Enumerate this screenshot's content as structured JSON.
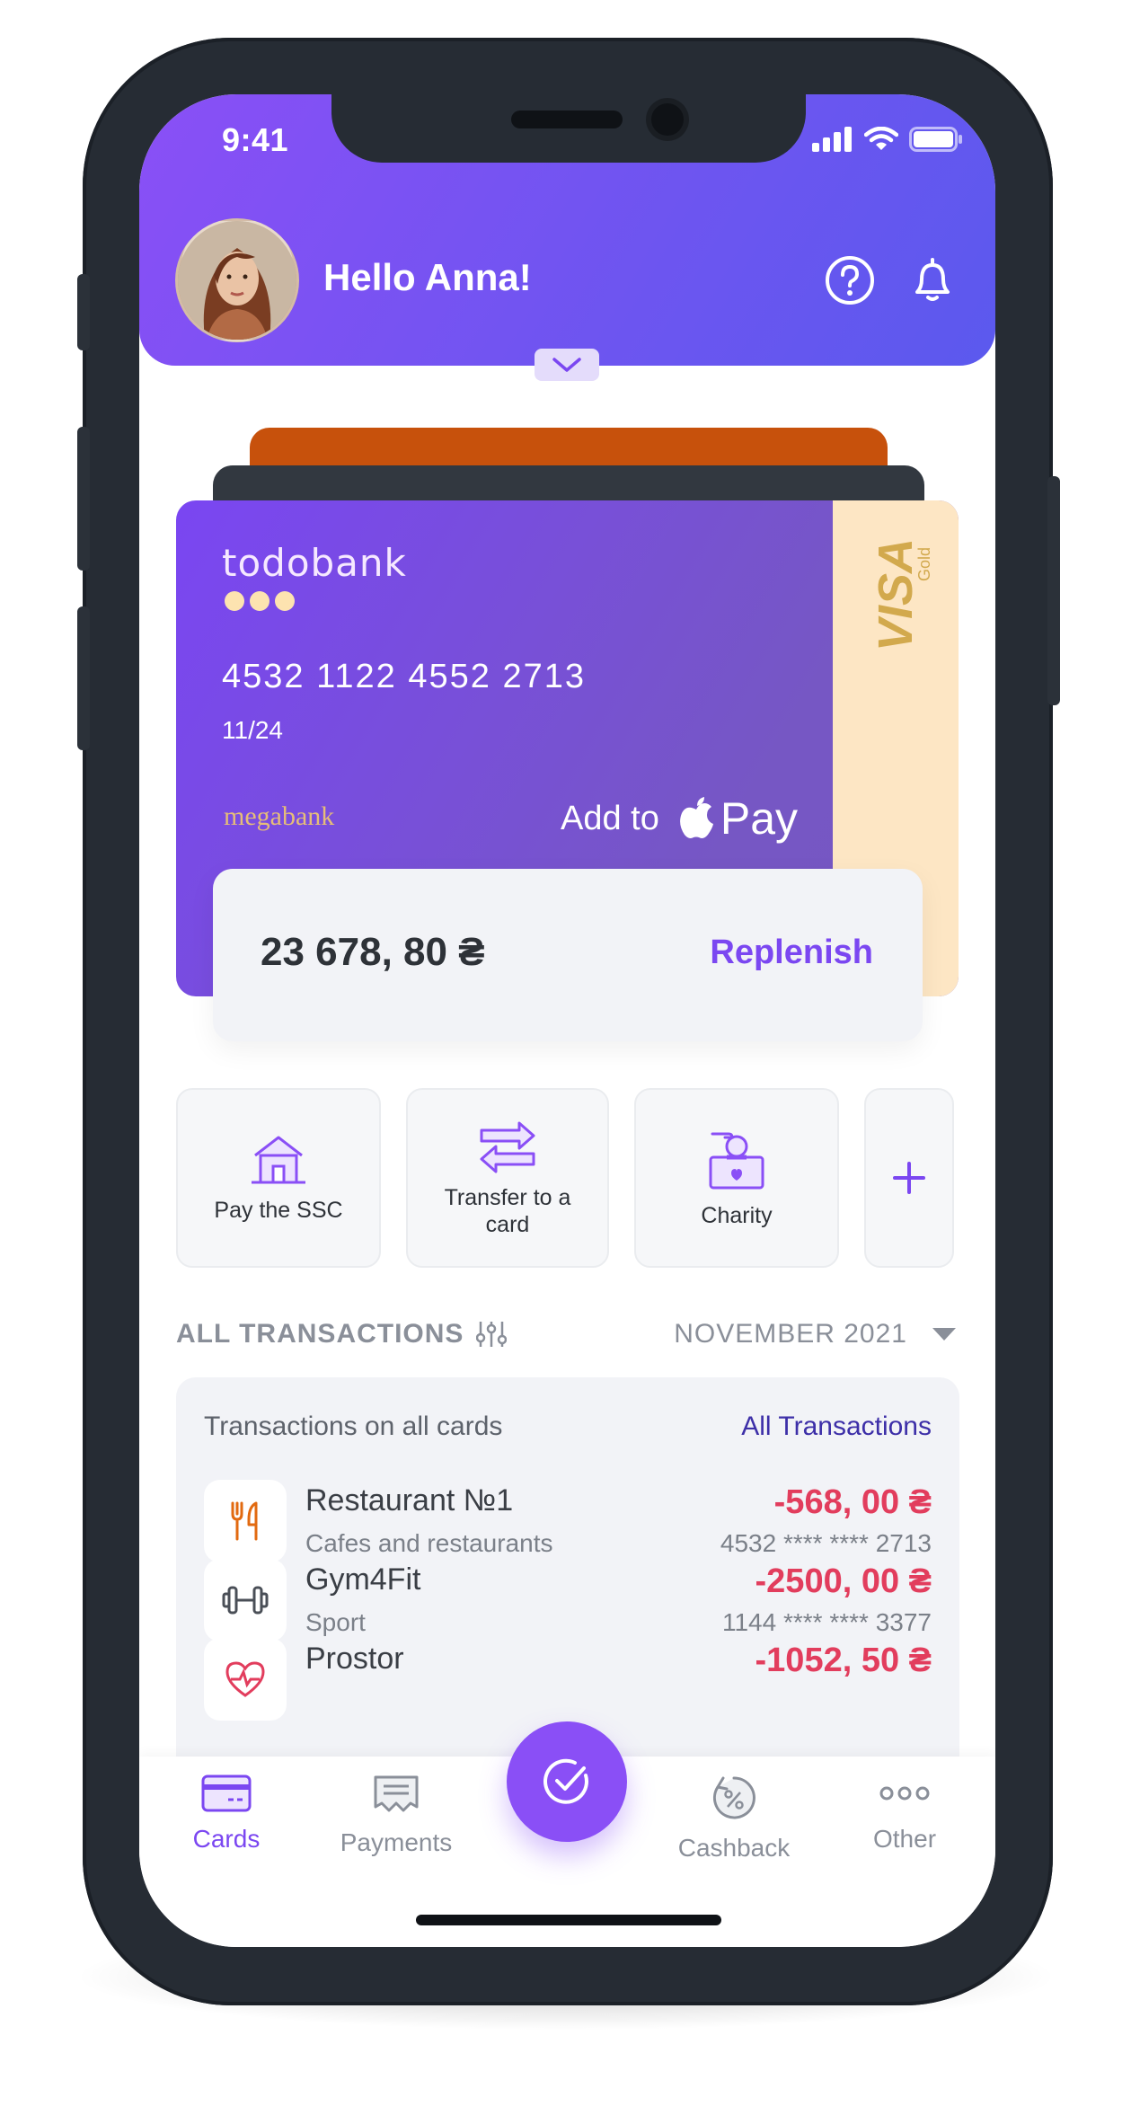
{
  "status": {
    "time": "9:41"
  },
  "header": {
    "greeting": "Hello Anna!"
  },
  "card": {
    "bank": "todobank",
    "number": "4532  1122  4552  2713",
    "expiry": "11/24",
    "issuer": "megabank",
    "add_to": "Add to",
    "pay": "Pay",
    "network": "VISA",
    "tier": "Gold"
  },
  "balance": {
    "amount": "23 678, 80 ₴",
    "replenish": "Replenish"
  },
  "actions": [
    {
      "label": "Pay the SSC",
      "icon": "house-icon"
    },
    {
      "label": "Transfer to a card",
      "icon": "transfer-arrows-icon"
    },
    {
      "label": "Charity",
      "icon": "donation-box-icon"
    }
  ],
  "transactions": {
    "heading": "ALL TRANSACTIONS",
    "month": "NOVEMBER 2021",
    "subtitle": "Transactions on all cards",
    "all_link": "All Transactions",
    "items": [
      {
        "title": "Restaurant №1",
        "category": "Cafes and restaurants",
        "amount": "-568, 00 ₴",
        "card": "4532 **** **** 2713",
        "icon": "fork-knife-icon"
      },
      {
        "title": "Gym4Fit",
        "category": "Sport",
        "amount": "-2500, 00 ₴",
        "card": "1144 **** **** 3377",
        "icon": "dumbbell-icon"
      },
      {
        "title": "Prostor",
        "category": "",
        "amount": "-1052, 50 ₴",
        "card": "",
        "icon": "heart-pulse-icon"
      }
    ]
  },
  "nav": [
    {
      "label": "Cards",
      "active": true
    },
    {
      "label": "Payments",
      "active": false
    },
    {
      "label": "Cashback",
      "active": false
    },
    {
      "label": "Other",
      "active": false
    }
  ],
  "colors": {
    "accent": "#7b47f1",
    "negative": "#e23d5d",
    "header_start": "#8a4ff6",
    "header_end": "#5b59ee"
  }
}
